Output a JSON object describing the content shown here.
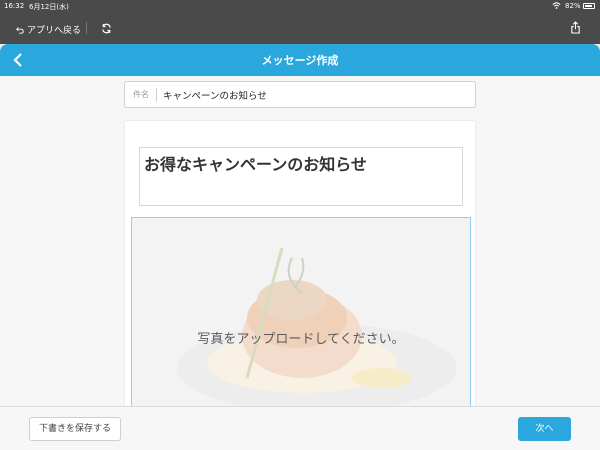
{
  "status_bar": {
    "time": "16:32",
    "date": "6月12日(水)",
    "battery": "82%",
    "battery_level": 0.82
  },
  "toolbar": {
    "back_to_app": "アプリへ戻る",
    "icons": [
      "undo-arrow-icon",
      "refresh-icon",
      "share-icon"
    ]
  },
  "header": {
    "title": "メッセージ作成",
    "back_icon": "chevron-left-icon",
    "color": "#2aa7dd"
  },
  "form": {
    "subject_label": "件名",
    "subject_value": "キャンペーンのお知らせ",
    "headline": "お得なキャンペーンのお知らせ",
    "photo_prompt": "写真をアップロードしてください。"
  },
  "footer": {
    "save_draft": "下書きを保存する",
    "next": "次へ"
  }
}
